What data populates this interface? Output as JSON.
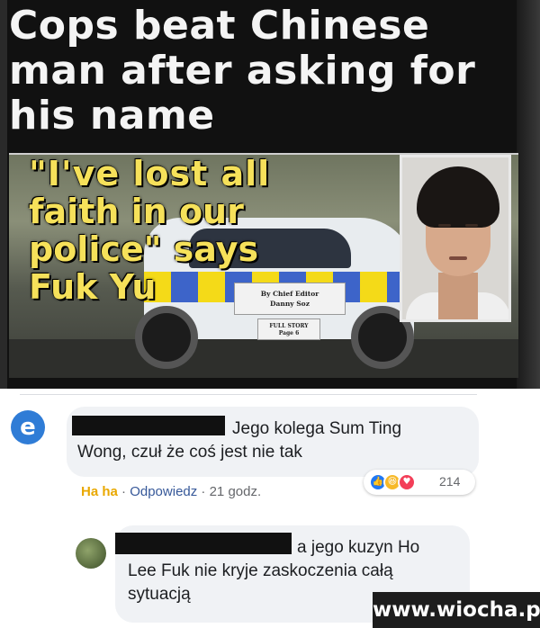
{
  "article": {
    "headline_line1": "Cops beat Chinese",
    "headline_line2": "man after asking for",
    "headline_line3": "his name",
    "quote_line1": "\"I've lost all",
    "quote_line2": "faith in our",
    "quote_line3": "police\" says",
    "quote_line4": "Fuk Yu",
    "byline_line1": "By Chief Editor",
    "byline_line2": "Danny Soz",
    "fullstory_line1": "FULL STORY",
    "fullstory_line2": "Page 6"
  },
  "comments": [
    {
      "text": "Jego kolega Sum Ting Wong, czuł że coś jest nie tak",
      "reaction_count": "214",
      "actions": {
        "haha": "Ha ha",
        "sep1": " · ",
        "reply": "Odpowiedz",
        "sep2": " · ",
        "time": "21 godz."
      }
    },
    {
      "text": "a jego kuzyn Ho Lee Fuk nie kryje zaskoczenia całą sytuacją"
    }
  ],
  "watermark": "www.wiocha.pl",
  "icons": {
    "avatar1": "app-logo-avatar",
    "like": "like-reaction-icon",
    "haha": "haha-reaction-icon",
    "love": "love-reaction-icon"
  },
  "colors": {
    "fb_bubble": "#f0f2f5",
    "fb_link": "#365899",
    "haha_yellow": "#e9a800",
    "like_blue": "#2078f4",
    "love_red": "#f33e58"
  }
}
